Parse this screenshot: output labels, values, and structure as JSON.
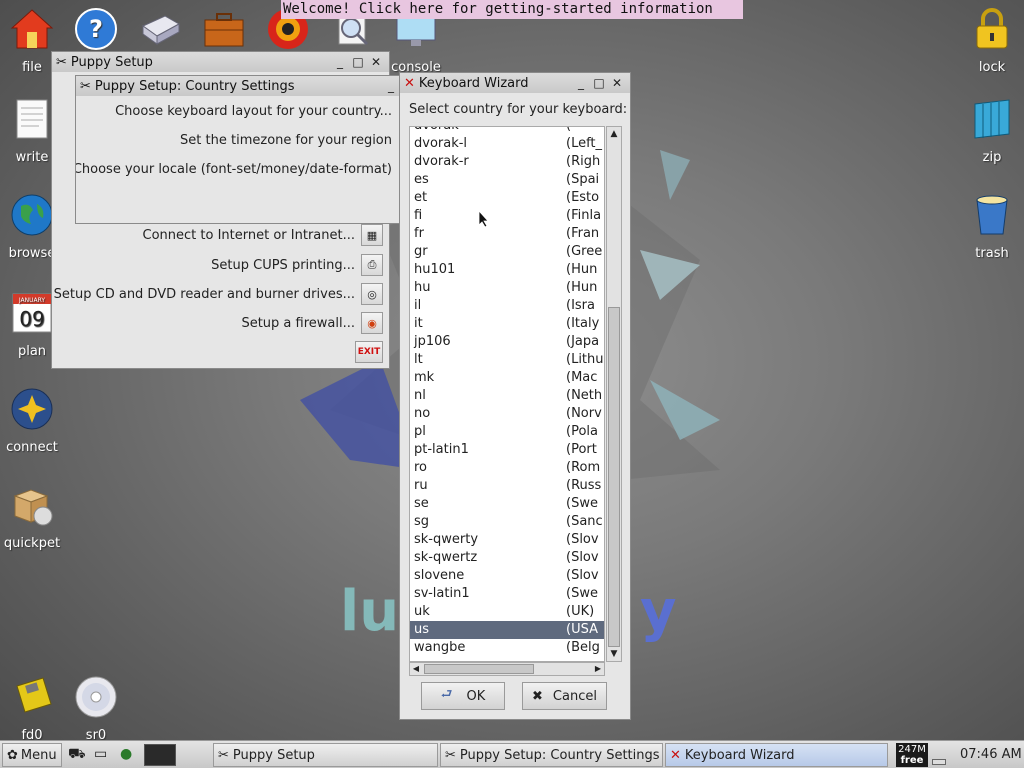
{
  "welcome": {
    "text": "Welcome! Click here for getting-started information"
  },
  "desktop_icons_left": [
    {
      "label": "file"
    },
    {
      "label": "write"
    },
    {
      "label": "browse"
    },
    {
      "label": "plan"
    },
    {
      "label": "connect"
    },
    {
      "label": "quickpet"
    },
    {
      "label": "fd0"
    },
    {
      "label": "sr0"
    }
  ],
  "desktop_icons_right": [
    {
      "label": "lock"
    },
    {
      "label": "zip"
    },
    {
      "label": "trash"
    }
  ],
  "desktop_icons_top": [
    {
      "label": "console"
    }
  ],
  "calendar_day": "09",
  "calendar_month": "JANUARY",
  "wallpaper_text": {
    "left": "lu",
    "right": "y"
  },
  "puppy_setup": {
    "title": "Puppy Setup",
    "items": [
      {
        "label": "Connect to Internet or Intranet..."
      },
      {
        "label": "Setup CUPS printing..."
      },
      {
        "label": "Setup CD and DVD reader and burner drives..."
      },
      {
        "label": "Setup a firewall..."
      }
    ],
    "exit_label": "EXIT"
  },
  "country_settings": {
    "title": "Puppy Setup: Country Settings",
    "items": [
      {
        "label": "Choose keyboard layout for your country..."
      },
      {
        "label": "Set the timezone for your region"
      },
      {
        "label": "Choose your locale (font-set/money/date-format)"
      }
    ]
  },
  "keyboard_wizard": {
    "title": "Keyboard Wizard",
    "prompt": "Select country for your keyboard:",
    "ok_label": "OK",
    "cancel_label": "Cancel",
    "layouts": [
      {
        "code": "dvorak",
        "country": "("
      },
      {
        "code": "dvorak-l",
        "country": "(Left_"
      },
      {
        "code": "dvorak-r",
        "country": "(Righ"
      },
      {
        "code": "es",
        "country": "(Spai"
      },
      {
        "code": "et",
        "country": "(Esto"
      },
      {
        "code": "fi",
        "country": "(Finla"
      },
      {
        "code": "fr",
        "country": "(Fran"
      },
      {
        "code": "gr",
        "country": "(Gree"
      },
      {
        "code": "hu101",
        "country": "(Hun"
      },
      {
        "code": "hu",
        "country": "(Hun"
      },
      {
        "code": "il",
        "country": "(Isra"
      },
      {
        "code": "it",
        "country": "(Italy"
      },
      {
        "code": "jp106",
        "country": "(Japa"
      },
      {
        "code": "lt",
        "country": "(Lithu"
      },
      {
        "code": "mk",
        "country": "(Mac"
      },
      {
        "code": "nl",
        "country": "(Neth"
      },
      {
        "code": "no",
        "country": "(Norv"
      },
      {
        "code": "pl",
        "country": "(Pola"
      },
      {
        "code": "pt-latin1",
        "country": "(Port"
      },
      {
        "code": "ro",
        "country": "(Rom"
      },
      {
        "code": "ru",
        "country": "(Russ"
      },
      {
        "code": "se",
        "country": "(Swe"
      },
      {
        "code": "sg",
        "country": "(Sanc"
      },
      {
        "code": "sk-qwerty",
        "country": "(Slov"
      },
      {
        "code": "sk-qwertz",
        "country": "(Slov"
      },
      {
        "code": "slovene",
        "country": "(Slov"
      },
      {
        "code": "sv-latin1",
        "country": "(Swe"
      },
      {
        "code": "uk",
        "country": "(UK)"
      },
      {
        "code": "us",
        "country": "(USA",
        "selected": true
      },
      {
        "code": "wangbe",
        "country": "(Belg"
      }
    ]
  },
  "taskbar": {
    "menu_label": "Menu",
    "tasks": [
      {
        "label": "Puppy Setup"
      },
      {
        "label": "Puppy Setup: Country Settings"
      },
      {
        "label": "Keyboard Wizard"
      }
    ],
    "free_mem": "247M",
    "free_label": "free",
    "clock": "07:46 AM"
  },
  "colors": {
    "selection": "#5f6a7e",
    "welcome_bg": "#e8c6e0",
    "active_task": "#b7c9e8"
  }
}
